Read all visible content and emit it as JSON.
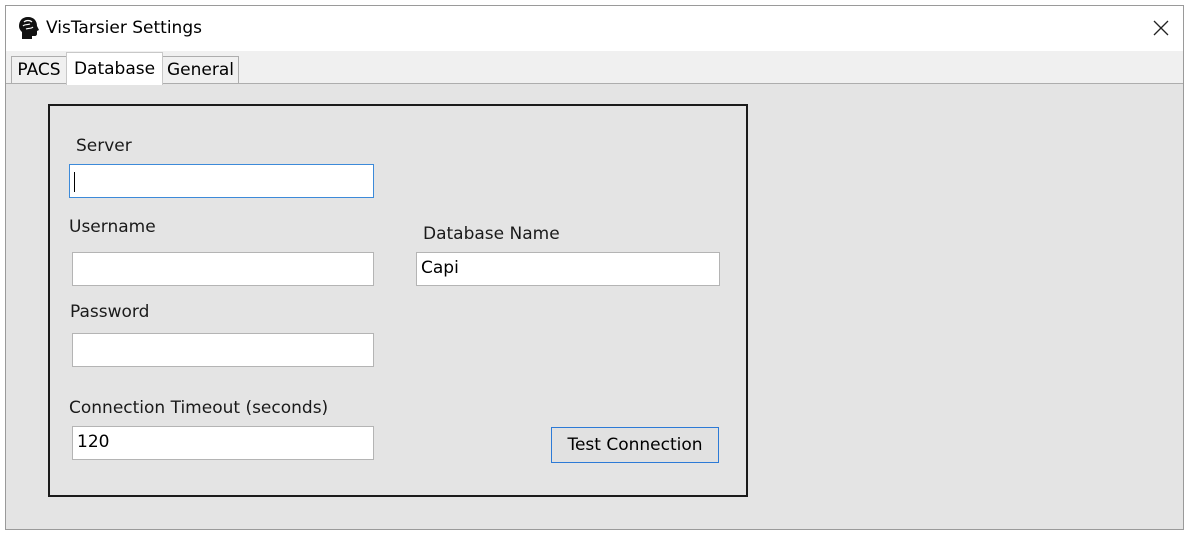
{
  "window": {
    "title": "VisTarsier Settings",
    "app_icon": "brain-head-icon",
    "close_icon": "close-icon"
  },
  "tabs": [
    {
      "label": "PACS",
      "active": false
    },
    {
      "label": "Database",
      "active": true
    },
    {
      "label": "General",
      "active": false
    }
  ],
  "database": {
    "server_label": "Server",
    "server_value": "",
    "username_label": "Username",
    "username_value": "",
    "password_label": "Password",
    "password_value": "",
    "dbname_label": "Database Name",
    "dbname_value": "Capi",
    "timeout_label": "Connection Timeout (seconds)",
    "timeout_value": "120",
    "test_button_label": "Test Connection"
  },
  "colors": {
    "focus_border": "#3c8ad9",
    "button_border": "#2c7ad6",
    "window_bg": "#e4e4e4"
  }
}
